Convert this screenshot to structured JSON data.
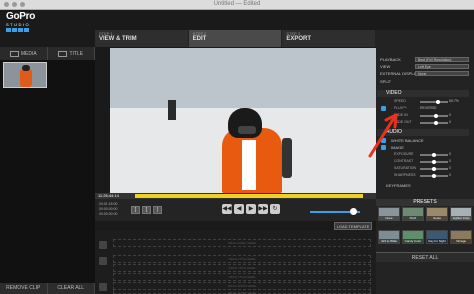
{
  "window": {
    "title": "Untitled — Edited"
  },
  "logo": {
    "line1": "GoPro",
    "line2": "STUDIO"
  },
  "left_tabs": [
    {
      "label": "MEDIA"
    },
    {
      "label": "TITLE"
    }
  ],
  "left_buttons": {
    "remove": "REMOVE CLIP",
    "clear": "CLEAR ALL"
  },
  "steps": [
    {
      "num": "STEP 1",
      "label": "VIEW & TRIM"
    },
    {
      "num": "STEP 2",
      "label": "EDIT"
    },
    {
      "num": "STEP 3",
      "label": "EXPORT"
    }
  ],
  "timeline": {
    "time": "11:26:44:14"
  },
  "transport": {
    "info_lines": [
      "00:01:18:00",
      "00:00:00:00",
      "00:00:00:00"
    ]
  },
  "load_template": "LOAD TEMPLATE",
  "tracks": [
    "DRAG VIDEO HERE",
    "DRAG TITLE HERE",
    "DRAG TITLE HERE",
    "DRAG TITLE HERE",
    "DRAG AUDIO HERE",
    "DRAG AUDIO HERE"
  ],
  "right_panel": {
    "playback": {
      "label": "PLAYBACK",
      "value": "Best (Full Resolution)"
    },
    "view": {
      "label": "VIEW",
      "value": "Left Eye"
    },
    "external": {
      "label": "EXTERNAL DISPLAY",
      "value": "None"
    },
    "split": {
      "label": "SPLIT"
    },
    "video_head": "VIDEO",
    "video_params": [
      {
        "label": "SPEED",
        "value": "65.7%"
      },
      {
        "label": "FLUX™",
        "value": "REVERSE"
      },
      {
        "label": "FADE IN",
        "value": "0"
      },
      {
        "label": "FADE OUT",
        "value": "0"
      }
    ],
    "audio_head": "AUDIO",
    "white_balance": "WHITE BALANCE",
    "image_head": "IMAGE",
    "image_params": [
      {
        "label": "EXPOSURE",
        "value": "0"
      },
      {
        "label": "CONTRAST",
        "value": "0"
      },
      {
        "label": "SATURATION",
        "value": "0"
      },
      {
        "label": "SHARPNESS",
        "value": "0"
      }
    ],
    "keyframes": "KEYFRAMES"
  },
  "presets": {
    "head": "PRESETS",
    "tiles": [
      "None",
      "FlipX",
      "Sepia",
      "Lighter Crop",
      "4x3 to Wide",
      "Candy Color",
      "Day for Night",
      "Vintage"
    ]
  },
  "reset_all": "RESET ALL"
}
